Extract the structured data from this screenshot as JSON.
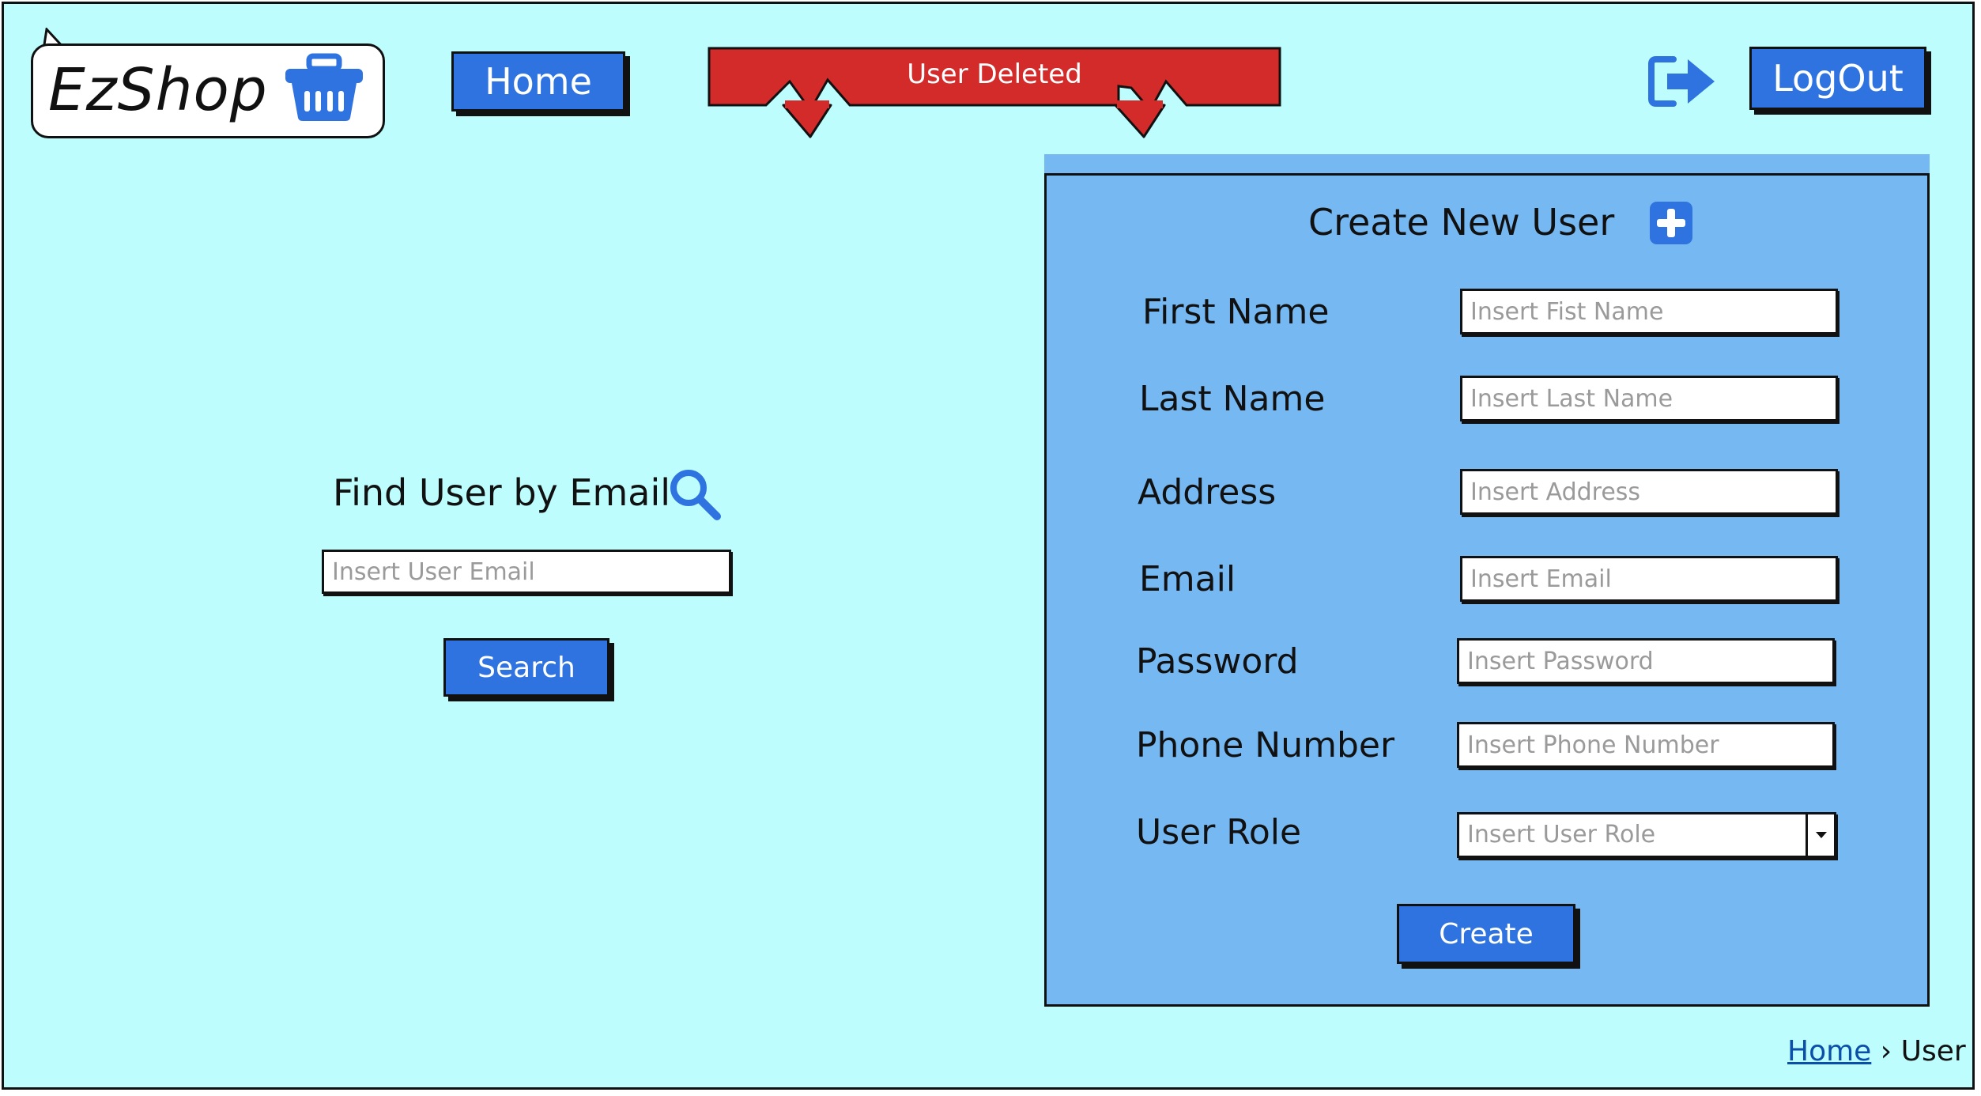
{
  "header": {
    "logo_text": "EzShop",
    "logo_icon": "basket-icon",
    "home_label": "Home",
    "alert_text": "User Deleted",
    "logout_label": "LogOut",
    "logout_icon": "logout-icon"
  },
  "search_panel": {
    "title": "Find User by Email",
    "icon": "search-icon",
    "email_placeholder": "Insert User Email",
    "search_label": "Search"
  },
  "create_panel": {
    "title": "Create New User",
    "icon": "plus-icon",
    "fields": [
      {
        "label": "First Name",
        "placeholder": "Insert Fist Name"
      },
      {
        "label": "Last Name",
        "placeholder": "Insert Last Name"
      },
      {
        "label": "Address",
        "placeholder": "Insert Address"
      },
      {
        "label": "Email",
        "placeholder": "Insert Email"
      },
      {
        "label": "Password",
        "placeholder": "Insert Password"
      },
      {
        "label": "Phone Number",
        "placeholder": "Insert Phone Number"
      }
    ],
    "role": {
      "label": "User Role",
      "placeholder": "Insert User Role"
    },
    "create_label": "Create"
  },
  "breadcrumb": {
    "home": "Home",
    "separator": "›",
    "current": "User"
  },
  "colors": {
    "background": "#bdfdfd",
    "button": "#2e73e0",
    "panel": "#76b8f2",
    "alert": "#d32a2a",
    "icon_blue": "#2e73e0"
  }
}
